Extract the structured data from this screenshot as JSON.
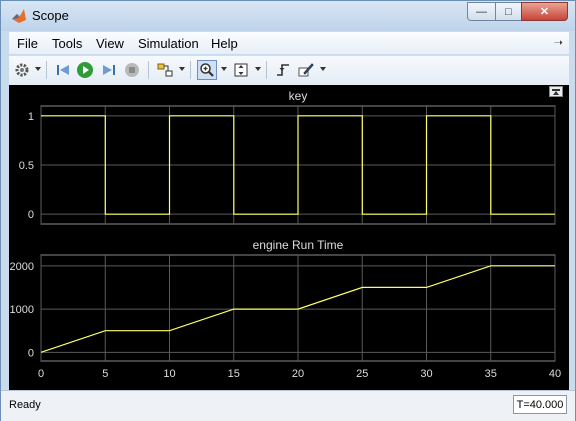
{
  "window": {
    "title": "Scope"
  },
  "menu": [
    "File",
    "Tools",
    "View",
    "Simulation",
    "Help"
  ],
  "status": {
    "text": "Ready",
    "time": "T=40.000"
  },
  "colors": {
    "plot_bg": "#000000",
    "trace": "#ffff66",
    "axis_text": "#dddddd",
    "grid": "#5a5a5a"
  },
  "chart_data": [
    {
      "type": "line",
      "title": "key",
      "xlim": [
        0,
        40
      ],
      "ylim": [
        -0.1,
        1.1
      ],
      "yticks": [
        0,
        0.5,
        1
      ],
      "ytick_labels": [
        "0",
        "0.5",
        "1"
      ],
      "xticks": [
        0,
        5,
        10,
        15,
        20,
        25,
        30,
        35,
        40
      ],
      "x": [
        0,
        5,
        5,
        10,
        10,
        15,
        15,
        20,
        20,
        25,
        25,
        30,
        30,
        35,
        35,
        40
      ],
      "y": [
        1,
        1,
        0,
        0,
        1,
        1,
        0,
        0,
        1,
        1,
        0,
        0,
        1,
        1,
        0,
        0
      ]
    },
    {
      "type": "line",
      "title": "engine Run Time",
      "xlim": [
        0,
        40
      ],
      "ylim": [
        -200,
        2250
      ],
      "yticks": [
        0,
        1000,
        2000
      ],
      "ytick_labels": [
        "0",
        "1000",
        "2000"
      ],
      "xticks": [
        0,
        5,
        10,
        15,
        20,
        25,
        30,
        35,
        40
      ],
      "xtick_labels": [
        "0",
        "5",
        "10",
        "15",
        "20",
        "25",
        "30",
        "35",
        "40"
      ],
      "x": [
        0,
        5,
        10,
        15,
        20,
        25,
        30,
        35,
        40
      ],
      "y": [
        0,
        500,
        500,
        1000,
        1000,
        1500,
        1500,
        2000,
        2000
      ]
    }
  ]
}
